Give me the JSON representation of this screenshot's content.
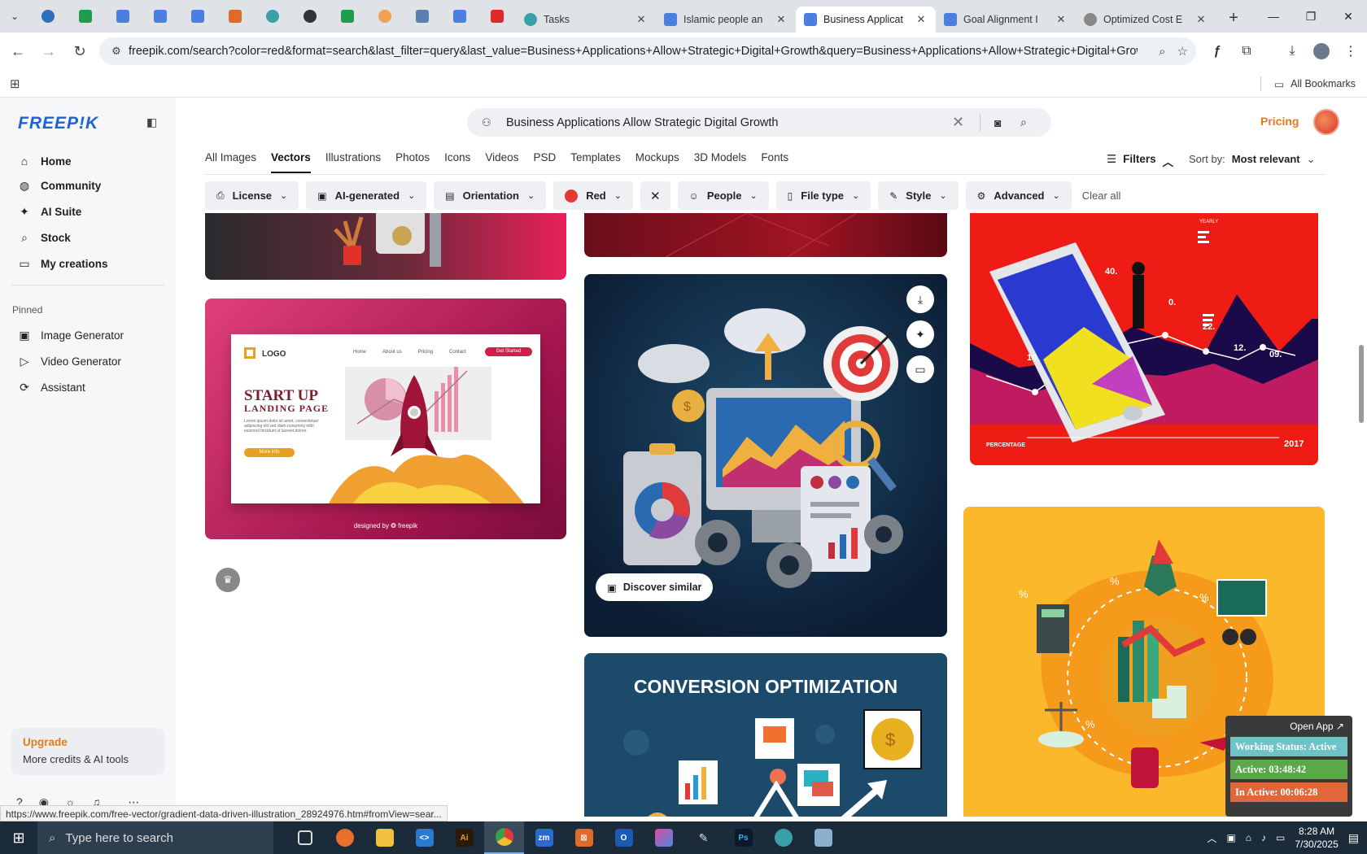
{
  "browser": {
    "tabs": [
      {
        "title": "Tasks",
        "color": "#3aa0a8"
      },
      {
        "title": "Islamic people an",
        "color": "#4a7fe0"
      },
      {
        "title": "Business Applicat",
        "color": "#4a7fe0",
        "active": true
      },
      {
        "title": "Goal Alignment I",
        "color": "#4a7fe0"
      },
      {
        "title": "Optimized Cost E",
        "color": "#888888"
      }
    ],
    "url": "freepik.com/search?color=red&format=search&last_filter=query&last_value=Business+Applications+Allow+Strategic+Digital+Growth&query=Business+Applications+Allow+Strategic+Digital+Growt...",
    "bookmarks_label": "All Bookmarks"
  },
  "sidebar": {
    "logo": "FREEP!K",
    "nav": [
      {
        "label": "Home",
        "icon": "home-icon",
        "glyph": "⌂"
      },
      {
        "label": "Community",
        "icon": "globe-icon",
        "glyph": "◍"
      },
      {
        "label": "AI Suite",
        "icon": "sparkle-icon",
        "glyph": "✦"
      },
      {
        "label": "Stock",
        "icon": "search-icon",
        "glyph": "⌕"
      },
      {
        "label": "My creations",
        "icon": "folder-icon",
        "glyph": "▭"
      }
    ],
    "pinned_label": "Pinned",
    "pinned": [
      {
        "label": "Image Generator",
        "icon": "image-icon",
        "glyph": "▣"
      },
      {
        "label": "Video Generator",
        "icon": "video-icon",
        "glyph": "▷"
      },
      {
        "label": "Assistant",
        "icon": "assistant-icon",
        "glyph": "⟳"
      }
    ],
    "upgrade_title": "Upgrade",
    "upgrade_sub": "More credits & AI tools"
  },
  "search": {
    "query": "Business Applications Allow Strategic Digital Growth"
  },
  "header": {
    "pricing": "Pricing"
  },
  "type_tabs": [
    "All Images",
    "Vectors",
    "Illustrations",
    "Photos",
    "Icons",
    "Videos",
    "PSD",
    "Templates",
    "Mockups",
    "3D Models",
    "Fonts"
  ],
  "active_type_tab": "Vectors",
  "filters_label": "Filters",
  "sort": {
    "label": "Sort by:",
    "value": "Most relevant"
  },
  "chips": [
    {
      "label": "License"
    },
    {
      "label": "AI-generated"
    },
    {
      "label": "Orientation"
    },
    {
      "label": "Red",
      "color": "#e53935"
    },
    {
      "label": "People"
    },
    {
      "label": "File type"
    },
    {
      "label": "Style"
    },
    {
      "label": "Advanced"
    }
  ],
  "clear_all": "Clear all",
  "cards": {
    "landing": {
      "logo": "LOGO",
      "nav": [
        "Home",
        "About us",
        "Pricing",
        "Contact"
      ],
      "cta": "Get Started",
      "title1": "START UP",
      "title2": "LANDING PAGE",
      "body": "Lorem ipsum dolor sit amet, consectetuer adipiscing elit sed diam nonummy nibh euismod tincidunt ut laoreet dolore.",
      "more": "More info",
      "credit": "designed by ❂ freepik"
    },
    "discover_label": "Discover similar",
    "phone": {
      "y1": "40.",
      "y2": "10.",
      "y3": "22.",
      "y4": "12.",
      "y5": "09.",
      "y6": "0.",
      "percentage": "PERCENTAGE",
      "year": "2017",
      "label": "YEARLY"
    },
    "conversion_title": "CONVERSION OPTIMIZATION"
  },
  "status_url": "https://www.freepik.com/free-vector/gradient-data-driven-illustration_28924976.htm#fromView=sear...",
  "work_status": {
    "open_app": "Open App ↗",
    "status": "Working Status: Active",
    "active": "Active: 03:48:42",
    "inactive": "In Active: 00:06:28"
  },
  "taskbar": {
    "search_placeholder": "Type here to search",
    "time": "8:28 AM",
    "date": "7/30/2025"
  }
}
